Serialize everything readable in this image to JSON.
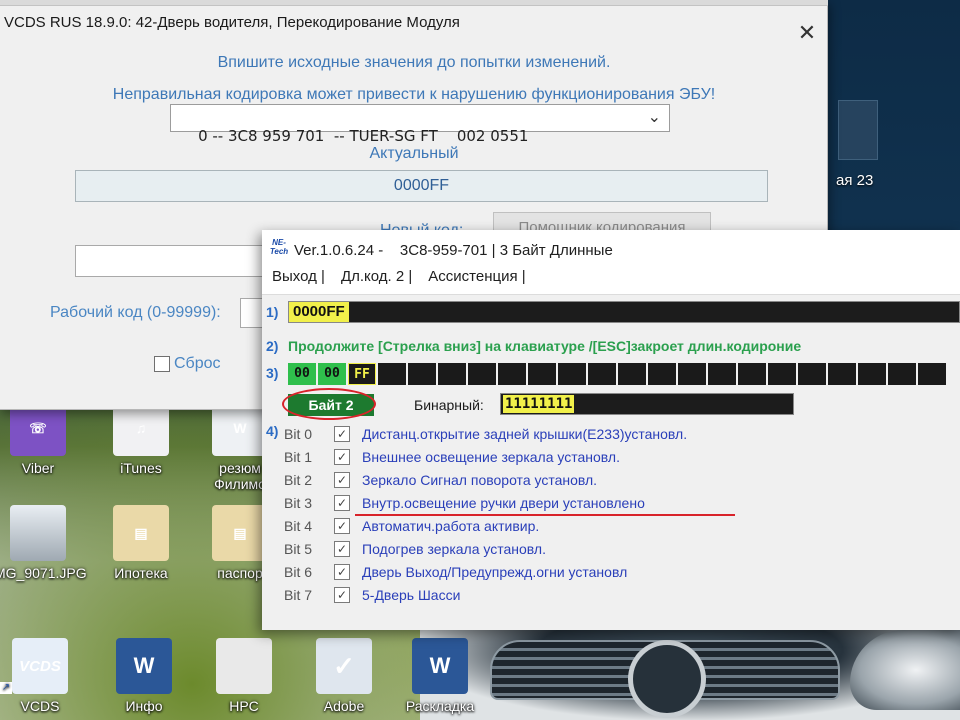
{
  "desktop": {
    "icons": [
      {
        "label": "Viber",
        "icon": "viber-icon"
      },
      {
        "label": "iTunes",
        "icon": "itunes-icon"
      },
      {
        "label": "резюм",
        "label2": "Филимо",
        "icon": "document-icon"
      },
      {
        "label": "MG_9071.JPG",
        "icon": "photo-icon"
      },
      {
        "label": "Ипотека",
        "icon": "folder-icon"
      },
      {
        "label": "паспор",
        "icon": "folder-icon"
      },
      {
        "label": "VCDS",
        "icon": "vcds-icon",
        "glyph": "VCDS"
      },
      {
        "label": "Инфо",
        "icon": "word-icon",
        "glyph": "W"
      },
      {
        "label": "НРС",
        "icon": "pdf-icon",
        "glyph": ""
      },
      {
        "label": "Adobe",
        "icon": "adobe-icon",
        "glyph": "✓"
      },
      {
        "label": "Раскладка",
        "icon": "word-icon",
        "glyph": "W"
      }
    ],
    "right_text": "ая 23"
  },
  "vcds": {
    "title": "VCDS RUS 18.9.0: 42-Дверь водителя,  Перекодирование Модуля",
    "msg1": "Впишите исходные значения до попытки изменений.",
    "msg2": "Неправильная кодировка может привести к нарушению функционирования ЭБУ!",
    "module_select": "0 -- 3C8 959 701  -- TUER-SG FT    002 0551",
    "label_actual": "Актуальный",
    "actual_value": "0000FF",
    "label_newcode": "Новый код:",
    "assist_button": "Помощник кодирования",
    "label_workcode": "Рабочий код (0-99999):",
    "reset_label": "Сброс"
  },
  "netech": {
    "logo": "NE-Tech",
    "title": "Ver.1.0.6.24 -    3C8-959-701 | 3 Байт Длинные",
    "menu": [
      "Выход |",
      "Дл.код. 2 |",
      "Ассистенция |"
    ],
    "row_numbers": [
      "1)",
      "2)",
      "3)",
      "4)"
    ],
    "coding_value": "0000FF",
    "hint": "Продолжите [Стрелка вниз] на клавиатуре /[ESC]закроет длин.кодироние",
    "bytes": [
      "00",
      "00",
      "FF",
      "",
      "",
      "",
      "",
      "",
      "",
      "",
      "",
      "",
      "",
      "",
      "",
      "",
      "",
      "",
      "",
      "",
      "",
      ""
    ],
    "byte_badge": "Байт 2",
    "binary_label": "Бинарный:",
    "binary_value": "11111111",
    "bits": [
      {
        "label": "Bit 0",
        "text": "Дистанц.открытие задней крышки(E233)установл.",
        "checked": true
      },
      {
        "label": "Bit 1",
        "text": "Внешнее освещение зеркала установл.",
        "checked": true
      },
      {
        "label": "Bit 2",
        "text": "Зеркало Сигнал поворота установл.",
        "checked": true
      },
      {
        "label": "Bit 3",
        "text": "Внутр.освещение ручки двери установлено",
        "checked": true
      },
      {
        "label": "Bit 4",
        "text": "Автоматич.работа активир.",
        "checked": true
      },
      {
        "label": "Bit 5",
        "text": "Подогрев зеркала   установл.",
        "checked": true
      },
      {
        "label": "Bit 6",
        "text": "Дверь Выход/Предупрежд.огни установл",
        "checked": true
      },
      {
        "label": "Bit 7",
        "text": "5-Дверь Шасси",
        "checked": true
      }
    ]
  },
  "colors": {
    "vcds_text": "#3e78b7",
    "green_bar": "#2fbf4c",
    "yellow_highlight": "#f1f04a",
    "bit_text": "#2a3fb9",
    "annotation_red": "#d8232a"
  }
}
